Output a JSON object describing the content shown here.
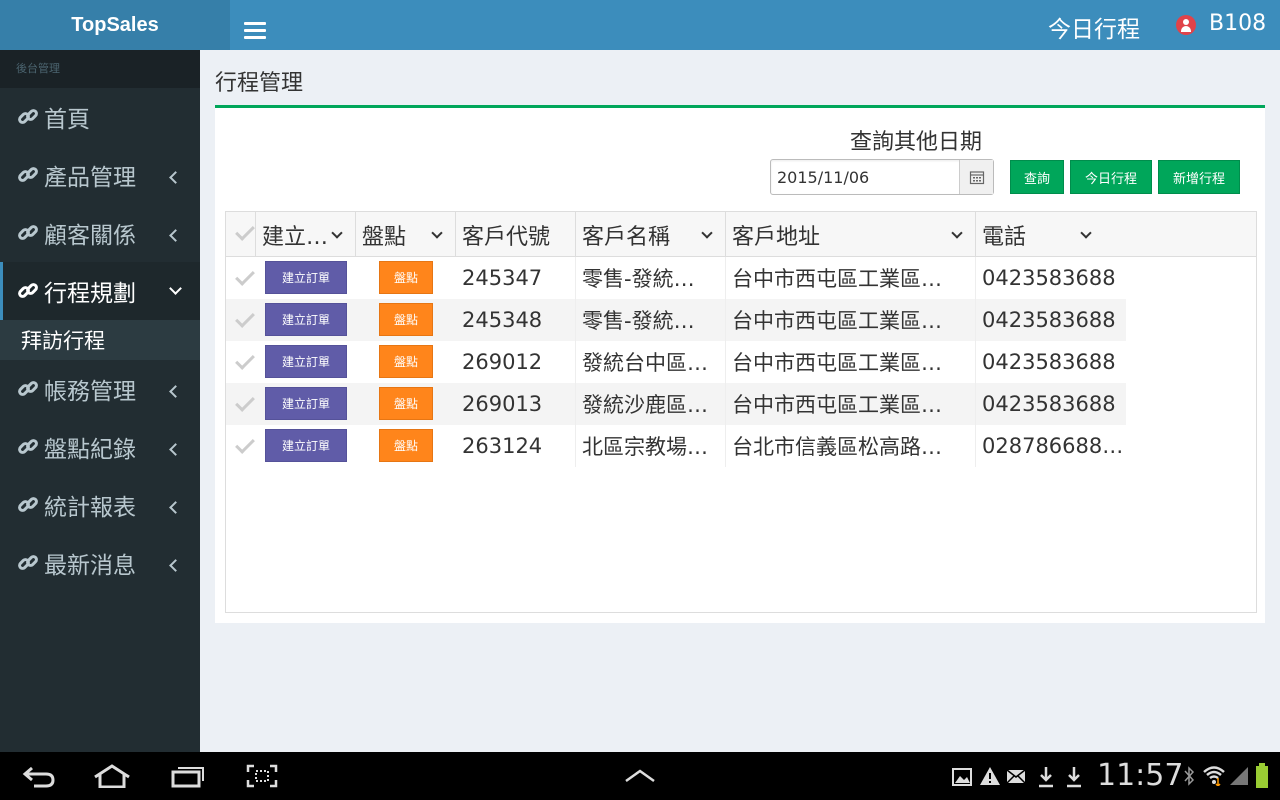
{
  "app": {
    "brand": "TopSales",
    "top_today": "今日行程",
    "user": "B108"
  },
  "sidebar": {
    "header": "後台管理",
    "items": [
      {
        "label": "首頁",
        "has_chevron": false
      },
      {
        "label": "產品管理",
        "has_chevron": true
      },
      {
        "label": "顧客關係",
        "has_chevron": true
      },
      {
        "label": "行程規劃",
        "active": true
      },
      {
        "label": "帳務管理",
        "has_chevron": true
      },
      {
        "label": "盤點紀錄",
        "has_chevron": true
      },
      {
        "label": "統計報表",
        "has_chevron": true
      },
      {
        "label": "最新消息",
        "has_chevron": true
      }
    ],
    "submenu": "拜訪行程"
  },
  "main": {
    "page_title": "行程管理",
    "query_label": "查詢其他日期",
    "date_value": "2015/11/06",
    "buttons": {
      "query": "查詢",
      "today": "今日行程",
      "add": "新增行程"
    }
  },
  "grid": {
    "columns": [
      "建立…",
      "盤點",
      "客戶代號",
      "客戶名稱",
      "客戶地址",
      "電話"
    ],
    "row_buttons": {
      "order": "建立訂單",
      "count": "盤點"
    },
    "rows": [
      {
        "id": "245347",
        "name": "零售-發統…",
        "address": "台中市西屯區工業區…",
        "phone": "0423583688"
      },
      {
        "id": "245348",
        "name": "零售-發統…",
        "address": "台中市西屯區工業區…",
        "phone": "0423583688"
      },
      {
        "id": "269012",
        "name": "發統台中區…",
        "address": "台中市西屯區工業區…",
        "phone": "0423583688"
      },
      {
        "id": "269013",
        "name": "發統沙鹿區…",
        "address": "台中市西屯區工業區…",
        "phone": "0423583688"
      },
      {
        "id": "263124",
        "name": "北區宗教場…",
        "address": "台北市信義區松高路…",
        "phone": "028786688…"
      }
    ]
  },
  "status_bar": {
    "time": "11:57"
  },
  "colors": {
    "header": "#3c8dbc",
    "brand": "#367fa9",
    "sidebar": "#222d32",
    "green": "#00a65a",
    "purple": "#605ca8",
    "orange": "#ff851b"
  }
}
